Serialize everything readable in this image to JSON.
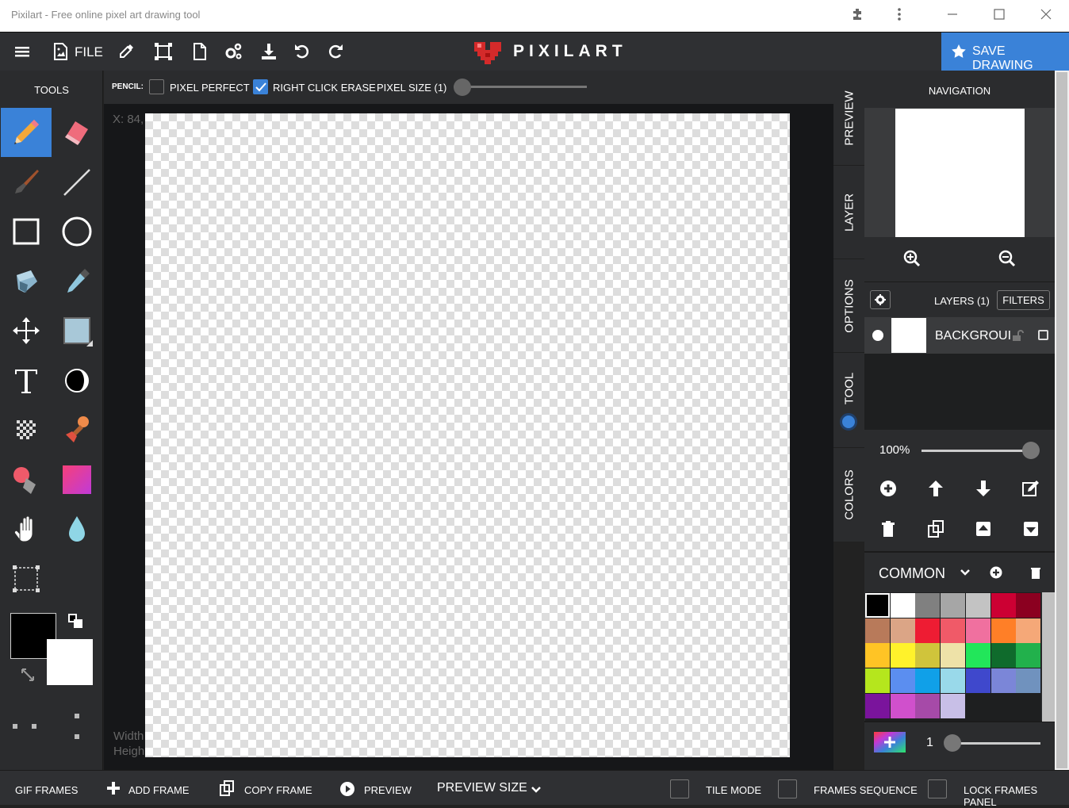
{
  "window": {
    "title": "Pixilart - Free online pixel art drawing tool",
    "minimize_icon": "minimize-icon",
    "maximize_icon": "maximize-icon",
    "close_icon": "close-icon"
  },
  "topbar": {
    "file_label": "FILE",
    "logo_text": "PIXILART",
    "save_label": "SAVE DRAWING",
    "accent": "#3a82d8"
  },
  "tools": {
    "title": "TOOLS",
    "active": "pencil"
  },
  "options": {
    "tool_label": "PENCIL:",
    "pixel_perfect_label": "PIXEL PERFECT",
    "pixel_perfect_checked": false,
    "right_click_erase_label": "RIGHT CLICK ERASE",
    "right_click_erase_checked": true,
    "pixel_size_label": "PIXEL SIZE (1)",
    "pixel_size_value": 1
  },
  "canvas": {
    "coord_text": "X: 84,",
    "width_text": "Width",
    "height_text": "Heigh"
  },
  "side_tabs": [
    "PREVIEW",
    "LAYER",
    "OPTIONS",
    "TOOL",
    "COLORS"
  ],
  "navigation": {
    "title": "NAVIGATION"
  },
  "layers": {
    "title": "LAYERS (1)",
    "filters_label": "FILTERS",
    "items": [
      {
        "name": "BACKGROUI"
      }
    ],
    "opacity_text": "100%",
    "opacity_fraction": 1.0
  },
  "palette": {
    "name": "COMMON",
    "colors": [
      "#000000",
      "#ffffff",
      "#808080",
      "#a6a6a6",
      "#c3c3c3",
      "#cc0033",
      "#8b0020",
      "#b87a5a",
      "#dba586",
      "#ee1c33",
      "#f05a68",
      "#f0709f",
      "#ff7f27",
      "#f5a878",
      "#ffc425",
      "#fff22b",
      "#d0c43b",
      "#eee2a8",
      "#22e65a",
      "#0f6b2c",
      "#22b14c",
      "#b5e61d",
      "#5b8ef0",
      "#10a0e8",
      "#99d9ea",
      "#3f48cc",
      "#7b86d8",
      "#7092be",
      "#7a149c",
      "#d050cc",
      "#a64aa8",
      "#c8bfe7"
    ],
    "brush_size": 1,
    "brush_size_text": "1"
  },
  "bottombar": {
    "gif_frames": "GIF FRAMES",
    "add_frame": "ADD FRAME",
    "copy_frame": "COPY FRAME",
    "preview": "PREVIEW",
    "preview_size": "PREVIEW SIZE",
    "tile_mode": "TILE MODE",
    "frames_sequence": "FRAMES SEQUENCE",
    "lock_frames_panel": "LOCK FRAMES PANEL"
  }
}
